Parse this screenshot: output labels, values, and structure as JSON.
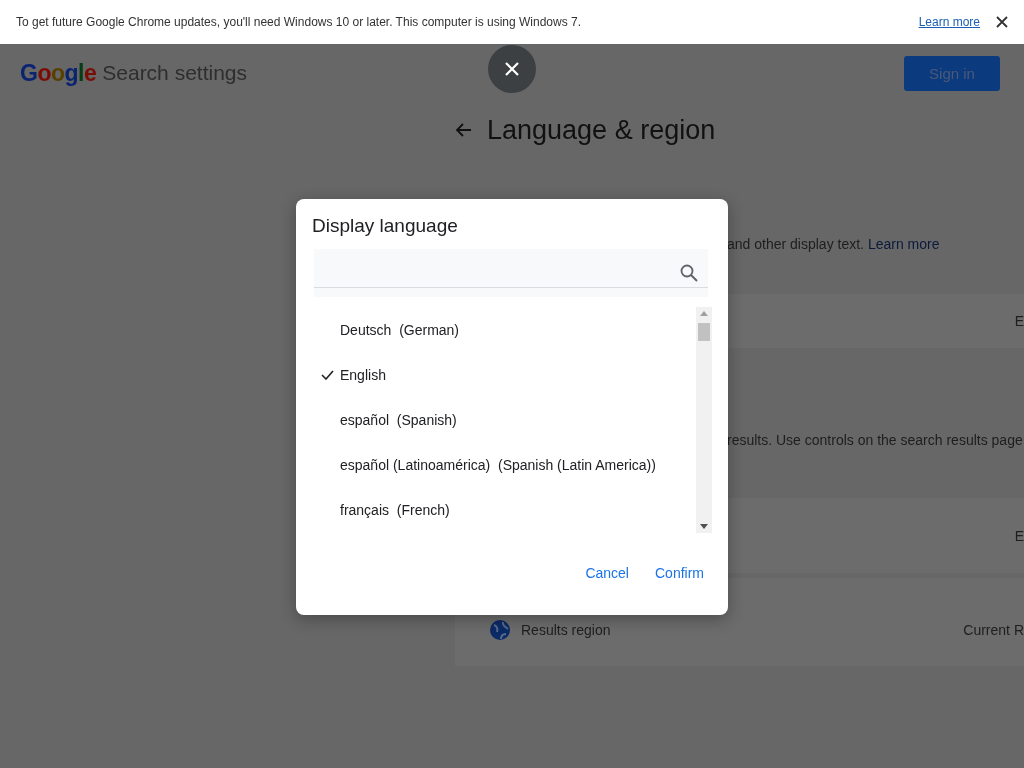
{
  "banner": {
    "message": "To get future Google Chrome updates, you'll need Windows 10 or later. This computer is using Windows 7.",
    "link": "Learn more"
  },
  "header": {
    "logo": "Google",
    "title": "Search settings",
    "sign_in": "Sign in"
  },
  "page": {
    "heading": "Language & region",
    "display_note": "and other display text.",
    "display_link": "Learn more",
    "results_note": "results. Use controls on the search results page",
    "rows": [
      {
        "kind": "value",
        "value": "E"
      },
      {
        "kind": "value",
        "value": "E"
      },
      {
        "kind": "globe",
        "label": "Results region",
        "value": "Current R"
      }
    ]
  },
  "dialog": {
    "title": "Display language",
    "languages": [
      {
        "label": "Deutsch  (German)",
        "selected": false
      },
      {
        "label": "English",
        "selected": true
      },
      {
        "label": "español  (Spanish)",
        "selected": false
      },
      {
        "label": "español (Latinoamérica)  (Spanish (Latin America))",
        "selected": false
      },
      {
        "label": "français  (French)",
        "selected": false
      }
    ],
    "cancel": "Cancel",
    "confirm": "Confirm"
  }
}
